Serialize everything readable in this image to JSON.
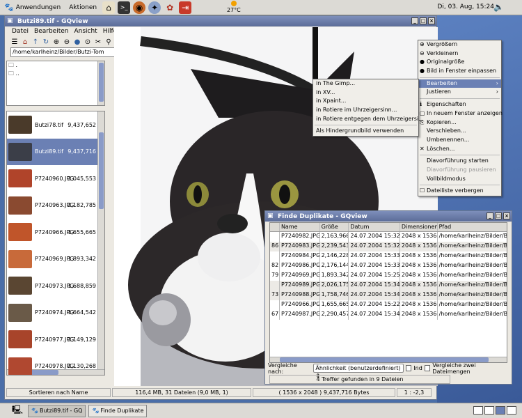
{
  "panel": {
    "menu_apps": "Anwendungen",
    "menu_actions": "Aktionen",
    "weather_temp": "27°C",
    "clock": "Di, 03. Aug, 15:24"
  },
  "window": {
    "title": "Butzi89.tif - GQview",
    "menu": [
      "Datei",
      "Bearbeiten",
      "Ansicht",
      "Hilfe"
    ],
    "path": "/home/karlheinz/Bilder/Butzi-Tom",
    "dirs": [
      ".",
      ".."
    ],
    "files": [
      {
        "name": "Butzi78.tif",
        "size": "9,437,652",
        "thumb": "#4a3a2a"
      },
      {
        "name": "Butzi89.tif",
        "size": "9,437,716",
        "thumb": "#3b3e48"
      },
      {
        "name": "P7240960.JPG",
        "size": "2,045,553",
        "thumb": "#b0442a"
      },
      {
        "name": "P7240963.JPG",
        "size": "2,182,785",
        "thumb": "#8a4a30"
      },
      {
        "name": "P7240966.JPG",
        "size": "1,655,665",
        "thumb": "#c0552a"
      },
      {
        "name": "P7240969.JPG",
        "size": "1,893,342",
        "thumb": "#c86a3a"
      },
      {
        "name": "P7240973.JPG",
        "size": "1,688,859",
        "thumb": "#5a4632"
      },
      {
        "name": "P7240974.JPG",
        "size": "1,664,542",
        "thumb": "#6a5a48"
      },
      {
        "name": "P7240977.JPG",
        "size": "2,149,129",
        "thumb": "#a8442a"
      },
      {
        "name": "P7240978.JPG",
        "size": "2,130,268",
        "thumb": "#b04830"
      }
    ],
    "status": {
      "sort": "Sortieren nach Name",
      "summary": "116,4 MB, 31 Dateien (9,0 MB, 1)",
      "image_info": "( 1536 x 2048 ) 9,437,716 Bytes",
      "zoom": "1 : -2,3"
    }
  },
  "context_menu": {
    "items": [
      {
        "label": "Vergrößern",
        "icon": "zoom-in-icon"
      },
      {
        "label": "Verkleinern",
        "icon": "zoom-out-icon"
      },
      {
        "label": "Originalgröße",
        "icon": "zoom-fit-icon"
      },
      {
        "label": "Bild in Fenster einpassen",
        "icon": "fit-window-icon"
      },
      {
        "label": "Bearbeiten",
        "submenu": true,
        "highlight": true
      },
      {
        "label": "Justieren",
        "submenu": true
      },
      {
        "label": "Eigenschaften",
        "icon": "properties-icon"
      },
      {
        "label": "In neuem Fenster anzeigen",
        "icon": "new-window-icon"
      },
      {
        "label": "Kopieren...",
        "icon": "copy-icon"
      },
      {
        "label": "Verschieben..."
      },
      {
        "label": "Umbenennen..."
      },
      {
        "label": "Löschen...",
        "icon": "delete-icon"
      },
      {
        "label": "Diavorführung starten"
      },
      {
        "label": "Diavorführung pausieren",
        "disabled": true
      },
      {
        "label": "Vollbildmodus"
      },
      {
        "label": "Dateiliste verbergen",
        "checkbox": true
      }
    ]
  },
  "submenu": {
    "items": [
      "in The Gimp...",
      "in XV...",
      "in Xpaint...",
      "in Rotiere im Uhrzeigersinn...",
      "in Rotiere entgegen dem Uhrzeigersi...",
      "Als Hindergrundbild verwenden"
    ]
  },
  "duplicates": {
    "title": "Finde Duplikate - GQview",
    "columns": [
      "",
      "Name",
      "Größe",
      "Datum",
      "Dimensionen",
      "Pfad"
    ],
    "rows": [
      [
        "",
        "P7240982.JPG",
        "2,163,966",
        "24.07.2004 15:32",
        "2048 x 1536",
        "/home/karlheinz/Bilder/Butzi"
      ],
      [
        "86",
        "P7240983.JPG",
        "2,239,543",
        "24.07.2004 15:32",
        "2048 x 1536",
        "/home/karlheinz/Bilder/Butzi"
      ],
      [
        "",
        "P7240984.JPG",
        "2,146,228",
        "24.07.2004 15:33",
        "2048 x 1536",
        "/home/karlheinz/Bilder/Butzi"
      ],
      [
        "82",
        "P7240986.JPG",
        "2,176,144",
        "24.07.2004 15:33",
        "2048 x 1536",
        "/home/karlheinz/Bilder/Butzi"
      ],
      [
        "79",
        "P7240969.JPG",
        "1,893,342",
        "24.07.2004 15:25",
        "2048 x 1536",
        "/home/karlheinz/Bilder/Butzi"
      ],
      [
        "",
        "P7240989.JPG",
        "2,026,175",
        "24.07.2004 15:34",
        "2048 x 1536",
        "/home/karlheinz/Bilder/Butzi"
      ],
      [
        "73",
        "P7240988.JPG",
        "1,758,746",
        "24.07.2004 15:34",
        "2048 x 1536",
        "/home/karlheinz/Bilder/Butzi"
      ],
      [
        "",
        "P7240966.JPG",
        "1,655,665",
        "24.07.2004 15:22",
        "2048 x 1536",
        "/home/karlheinz/Bilder/Butzi"
      ],
      [
        "67",
        "P7240987.JPG",
        "2,290,457",
        "24.07.2004 15:34",
        "2048 x 1536",
        "/home/karlheinz/Bilder/Butzi"
      ]
    ],
    "compare_label": "Vergleiche nach:",
    "compare_value": "Ähnlichkeit (benutzerdefiniert)",
    "include_label": "Ind",
    "two_sets_label": "Vergleiche zwei Dateimengen",
    "status": "4 Treffer gefunden in 9 Dateien"
  },
  "taskbar": {
    "tasks": [
      "Butzi89.tif - GQ",
      "Finde Duplikate"
    ]
  }
}
